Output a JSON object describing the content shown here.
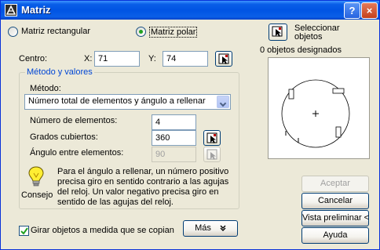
{
  "title": "Matriz",
  "titlebar": {
    "help_label": "?",
    "close_label": "×"
  },
  "mode": {
    "rectangular_label": "Matriz rectangular",
    "polar_label": "Matriz polar"
  },
  "select_objects": {
    "label_line1": "Seleccionar",
    "label_line2": "objetos",
    "count_text": "0 objetos designados"
  },
  "center": {
    "label": "Centro:",
    "x_label": "X:",
    "x_value": "71",
    "y_label": "Y:",
    "y_value": "74"
  },
  "method_group": {
    "legend": "Método y valores",
    "method_label": "Método:",
    "method_value": "Número total de elementos y ángulo a rellenar",
    "num_items_label": "Número de elementos:",
    "num_items_value": "4",
    "angle_fill_label": "Grados cubiertos:",
    "angle_fill_value": "360",
    "angle_between_label": "Ángulo entre elementos:",
    "angle_between_value": "90"
  },
  "tip": {
    "label": "Consejo",
    "text": "Para el ángulo a rellenar, un número positivo precisa giro en sentido contrario a las agujas del reloj. Un valor negativo precisa giro en sentido de las agujas del reloj."
  },
  "rotate_checkbox": {
    "label": "Girar objetos a medida que se copian",
    "checked": true
  },
  "more_button": {
    "label": "Más"
  },
  "buttons": {
    "ok": "Aceptar",
    "cancel": "Cancelar",
    "preview": "Vista preliminar <",
    "help": "Ayuda"
  },
  "colors": {
    "titlebar": "#0054e3",
    "dialog_bg": "#ece9d8",
    "legend_text": "#0046d5"
  }
}
